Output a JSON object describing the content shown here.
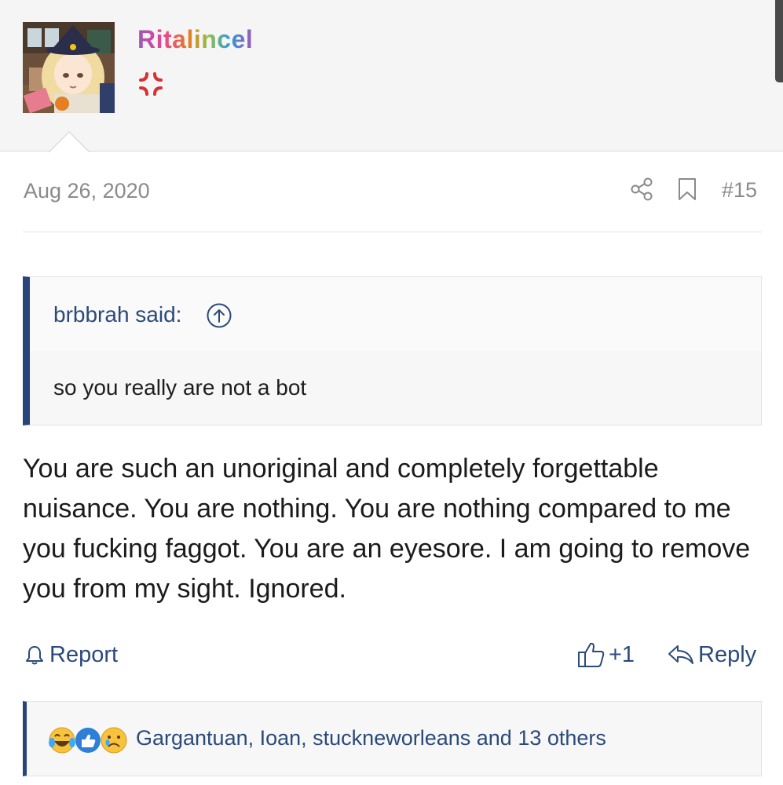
{
  "user": {
    "name": "Ritalincel",
    "emblem_icon": "anger-symbol-icon",
    "avatar_icon": "anime-girl-avatar"
  },
  "post": {
    "date": "Aug 26, 2020",
    "number": "#15",
    "share_icon": "share-icon",
    "bookmark_icon": "bookmark-icon",
    "body": "You are such an unoriginal and completely forgettable nuisance. You are nothing. You are nothing compared to me you fucking faggot. You are an eyesore. I am going to remove you from my sight. Ignored."
  },
  "quote": {
    "author": "brbbrah said:",
    "text": "so you really are not a bot",
    "jump_icon": "arrow-up-circle-icon"
  },
  "actions": {
    "report_label": "Report",
    "like_count": "+1",
    "reply_label": "Reply"
  },
  "reactions": {
    "icons": [
      "laugh-crying-icon",
      "like-icon",
      "sad-icon"
    ],
    "names": "Gargantuan, Ioan, stuckneworleans and 13 others"
  },
  "colors": {
    "accent": "#27457a",
    "link": "#2b4a7a",
    "muted": "#8a8a8a",
    "header_bg": "#f5f5f5"
  }
}
